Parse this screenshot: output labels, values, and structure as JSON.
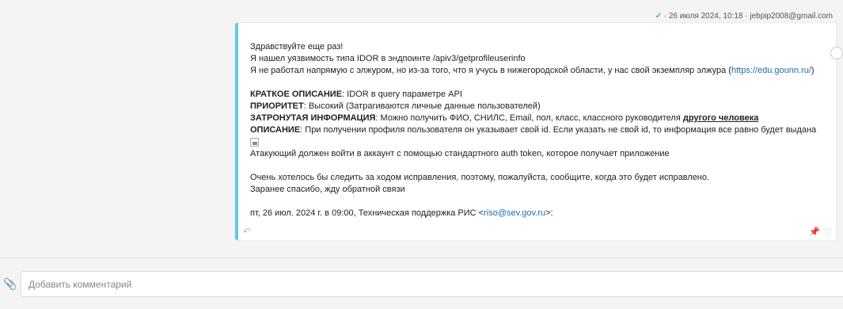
{
  "message": {
    "meta": {
      "date": "26 июля 2024, 10:18",
      "separator": "·",
      "sender": "jebpip2008@gmail.com"
    },
    "greeting": "Здравствуйте еще раз!",
    "line_found": "Я нашел уязвимость типа IDOR в эндпоинте /apiv3/getprofileuserinfo",
    "line_not_direct": "Я не работал напрямую с элжуром, но из-за того, что я учусь в нижегородской области, у нас свой экземпляр элжура (",
    "link_url": "https://edu.gounn.ru/",
    "line_not_direct_end": ")",
    "brief_label": "КРАТКОЕ ОПИСАНИЕ",
    "brief_value": ": IDOR в query параметре API",
    "priority_label": "ПРИОРИТЕТ",
    "priority_value": ": Высокий (Затрагиваются личные данные пользователей)",
    "affected_label": "ЗАТРОНУТАЯ ИНФОРМАЦИЯ",
    "affected_value": ": Можно получить ФИО, СНИЛС, Email, пол, класс, классного руководителя ",
    "affected_emph": "другого человека",
    "description_label": "ОПИСАНИЕ",
    "description_value": ": При получении профиля пользователя он указывает свой id. Если указать не свой id, то информация все равно будет выдана",
    "attacker_line": "Атакующий должен войти в аккаунт с помощью стандартного auth token, которое получает приложение",
    "follow_line": "Очень хотелось бы следить за ходом исправления, поэтому, пожалуйста, сообщите, когда это будет исправлено.",
    "thanks_line": "Заранее спасибо, жду обратной связи",
    "quote_header": "пт, 26 июл. 2024 г. в 09:00, Техническая поддержка РИС <",
    "quote_email": "riso@sev.gov.ru",
    "quote_header_end": ">:"
  },
  "composer": {
    "placeholder": "Добавить комментарий"
  },
  "colors": {
    "accent_border": "#63c8e9",
    "link": "#1a6fb5",
    "check": "#2e9d4f"
  }
}
